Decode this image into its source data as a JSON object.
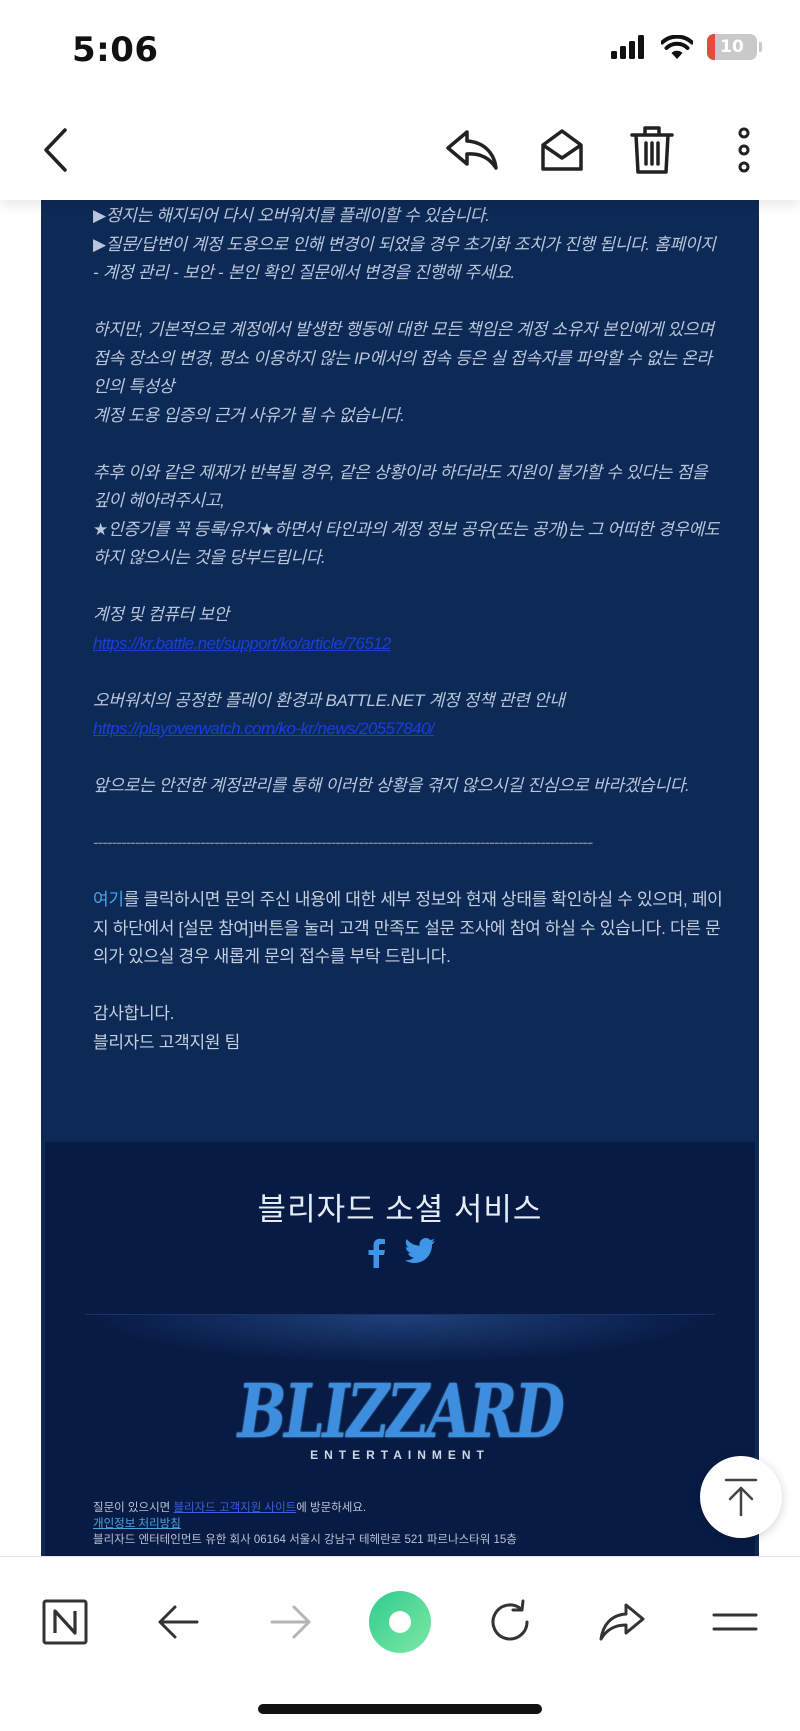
{
  "status": {
    "time": "5:06",
    "battery_label": "10",
    "battery_level": 0.1
  },
  "toolbar": {
    "back_icon": "chevron-left-icon",
    "reply_icon": "reply-icon",
    "mark_read_icon": "envelope-open-icon",
    "delete_icon": "trash-icon",
    "more_icon": "more-vertical-icon"
  },
  "email": {
    "lines": {
      "l1": "▶정지는 해지되어 다시 오버워치를 플레이할 수 있습니다.",
      "l2": "▶질문/답변이 계정 도용으로 인해 변경이 되었을 경우 초기화 조치가 진행 됩니다. 홈페이지 - 계정 관리 - 보안 - 본인 확인 질문에서 변경을 진행해 주세요.",
      "l3": "하지만, 기본적으로 계정에서 발생한 행동에 대한 모든 책임은 계정 소유자 본인에게 있으며",
      "l4": "접속 장소의 변경, 평소 이용하지 않는 IP에서의 접속 등은 실 접속자를 파악할 수 없는 온라인의 특성상",
      "l5": "계정 도용 입증의 근거 사유가 될 수 없습니다.",
      "l6": "추후 이와 같은 제재가 반복될 경우, 같은 상황이라 하더라도 지원이 불가할 수 있다는 점을 깊이 헤아려주시고,",
      "l7": "★인증기를 꼭 등록/유지★하면서 타인과의 계정 정보 공유(또는 공개)는 그 어떠한 경우에도 하지 않으시는 것을 당부드립니다.",
      "l8": "계정 및 컴퓨터 보안",
      "link1": "https://kr.battle.net/support/ko/article/76512",
      "l9": "오버워치의 공정한 플레이 환경과 BATTLE.NET 계정 정책 관련 안내",
      "link2": "https://playoverwatch.com/ko-kr/news/20557840/",
      "l10": "앞으로는 안전한 계정관리를 통해 이러한 상황을 겪지 않으시길 진심으로 바라겠습니다.",
      "divider": "-----------------------------------------------------------------------------------------------------------------------",
      "here_link": "여기",
      "l11": "를 클릭하시면 문의 주신 내용에 대한 세부 정보와 현재 상태를 확인하실 수 있으며, 페이지 하단에서 [설문 참여]버튼을 눌러 고객 만족도 설문 조사에 참여 하실 수 있습니다. 다른 문의가 있으실 경우 새롭게 문의 접수를 부탁 드립니다.",
      "thanks": "감사합니다.",
      "signature": "블리자드 고객지원 팀"
    }
  },
  "footer": {
    "social_title": "블리자드 소셜 서비스",
    "facebook_icon": "facebook-icon",
    "twitter_icon": "twitter-icon",
    "logo_text": "BLIZZARD",
    "logo_sub": "ENTERTAINMENT",
    "legal_prefix": "질문이 있으시면",
    "legal_link": "블리자드 고객지원 사이트",
    "legal_suffix": "에 방문하세요.",
    "privacy_link": "개인정보 처리방침",
    "address": "블리자드 엔터테인먼트 유한 회사 06164 서울시 강남구 테헤란로 521 파르나스타워 15층"
  },
  "browser_bar": {
    "home_icon": "n-logo-icon",
    "back_icon": "arrow-left-icon",
    "forward_icon": "arrow-right-icon",
    "center_icon": "green-dot-icon",
    "refresh_icon": "refresh-icon",
    "share_icon": "share-icon",
    "menu_icon": "menu-icon"
  }
}
